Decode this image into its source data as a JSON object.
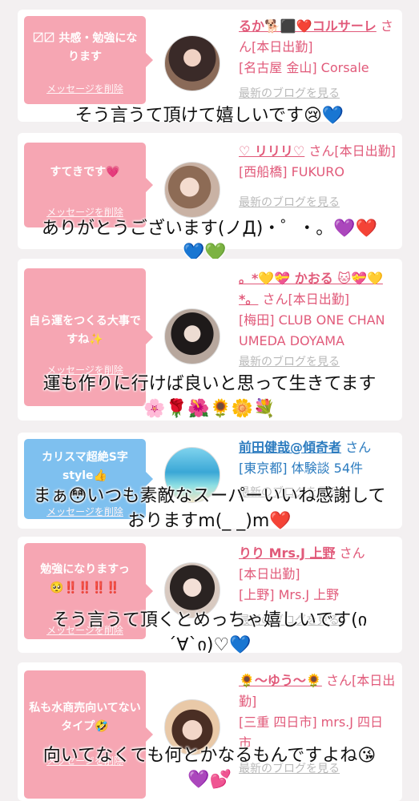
{
  "cards": [
    {
      "bubble_text": "〼〼 共感・勉強になります",
      "bubble_delete": "メッセージを削除",
      "name": "るか🐕⬛❤️コルサーレ",
      "san": "さん[本日出勤]",
      "shop": "[名古屋 金山] Corsale",
      "blog": "最新のブログを見る",
      "caption": "そう言うて頂けて嬉しいです😢💙"
    },
    {
      "bubble_text": "すてきです💗",
      "bubble_delete": "メッセージを削除",
      "name": "♡ リリリ♡",
      "san": "さん[本日出勤]",
      "shop": "[西船橋] FUKURO",
      "blog": "最新のブログを見る",
      "caption_line1": "ありがとうございます(ノД)・゜・。💜❤️",
      "caption_line2": "💙💚"
    },
    {
      "bubble_text": "自ら運をつくる大事ですね✨",
      "bubble_delete": "メッセージを削除",
      "name": "。*💛💝 かおる 🐱💝💛*。",
      "san": "さん[本日出勤]",
      "shop": "[梅田] CLUB ONE CHAN UMEDA DOYAMA",
      "blog": "最新のブログを見る",
      "caption_line1": "運も作りに行けば良いと思って生きてます",
      "caption_line2": "🌸🌹🌺🌻🌼💐"
    },
    {
      "bubble_text": "カリスマ超絶S字style👍",
      "bubble_delete": "メッセージを削除",
      "name": "前田健哉@傾奇者",
      "san": "さん",
      "shop": "[東京都] 体験談 54件",
      "blog": "最新のブログを見る",
      "caption_line1": "まぁ😳いつも素敵なスーパーいいね感謝して",
      "caption_line2": "おりますm(_ _)m❤️"
    },
    {
      "bubble_text": "勉強になりますっ🥺‼️‼️‼️‼️",
      "bubble_delete": "メッセージを削除",
      "name": "りり Mrs.J 上野",
      "san": "さん",
      "shop_line1": "[本日出勤]",
      "shop": "[上野] Mrs.J 上野",
      "blog": "最新のブログを見る",
      "caption_line1": "そう言うて頂くとめっちゃ嬉しいです(ი",
      "caption_line2": "´∀`ი)♡💙"
    },
    {
      "bubble_text": "私も水商売向いてないタイプ🤣",
      "bubble_delete": "メッセージを削除",
      "name": "🌻〜ゆう〜🌻",
      "san": "さん[本日出勤]",
      "shop": "[三重 四日市] mrs.J 四日市",
      "blog": "最新のブログを見る",
      "caption_line1": "向いてなくても何とかなるもんですよね😘",
      "caption_line2": "💜💕"
    }
  ],
  "colors": {
    "background": "#f3f0f1",
    "bubble_pink": "#f6a6b3",
    "bubble_blue": "#7ec0ef",
    "name_pink": "#e15a7a",
    "name_blue": "#2b7bbf",
    "blog_gray": "#b9b9b9"
  }
}
